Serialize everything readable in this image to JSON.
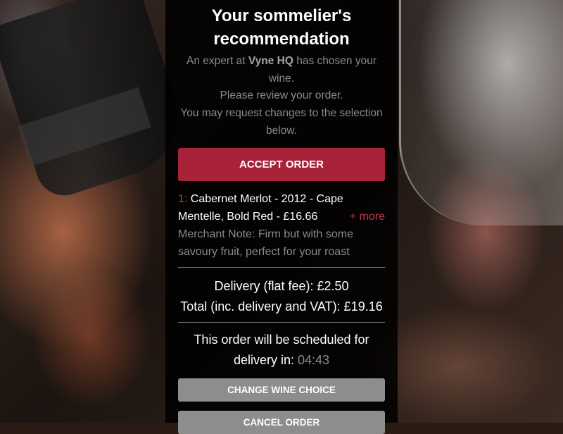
{
  "header": {
    "title": "Your sommelier's recommendation"
  },
  "intro": {
    "prefix": "An expert at ",
    "merchant": "Vyne HQ",
    "suffix": " has chosen your wine.",
    "line2": "Please review your order.",
    "line3": "You may request changes to the selection below."
  },
  "actions": {
    "accept_label": "Accept order",
    "change_label": "Change wine choice",
    "cancel_label": "Cancel order"
  },
  "wines": [
    {
      "number": "1:",
      "description": "Cabernet Merlot - 2012 - Cape Mentelle, Bold Red - £16.66",
      "more_label": "+ more",
      "merchant_note": "Merchant Note: Firm but with some savoury fruit, perfect for your roast"
    }
  ],
  "fees": {
    "delivery": "Delivery (flat fee): £2.50",
    "total": "Total (inc. delivery and VAT): £19.16"
  },
  "schedule": {
    "text": "This order will be scheduled for delivery in: ",
    "countdown": "04:43"
  },
  "colors": {
    "accent": "#a8223a",
    "accent_text": "#c0344e",
    "muted_text": "#8a8a8a",
    "secondary_button": "#8d8d8d"
  }
}
